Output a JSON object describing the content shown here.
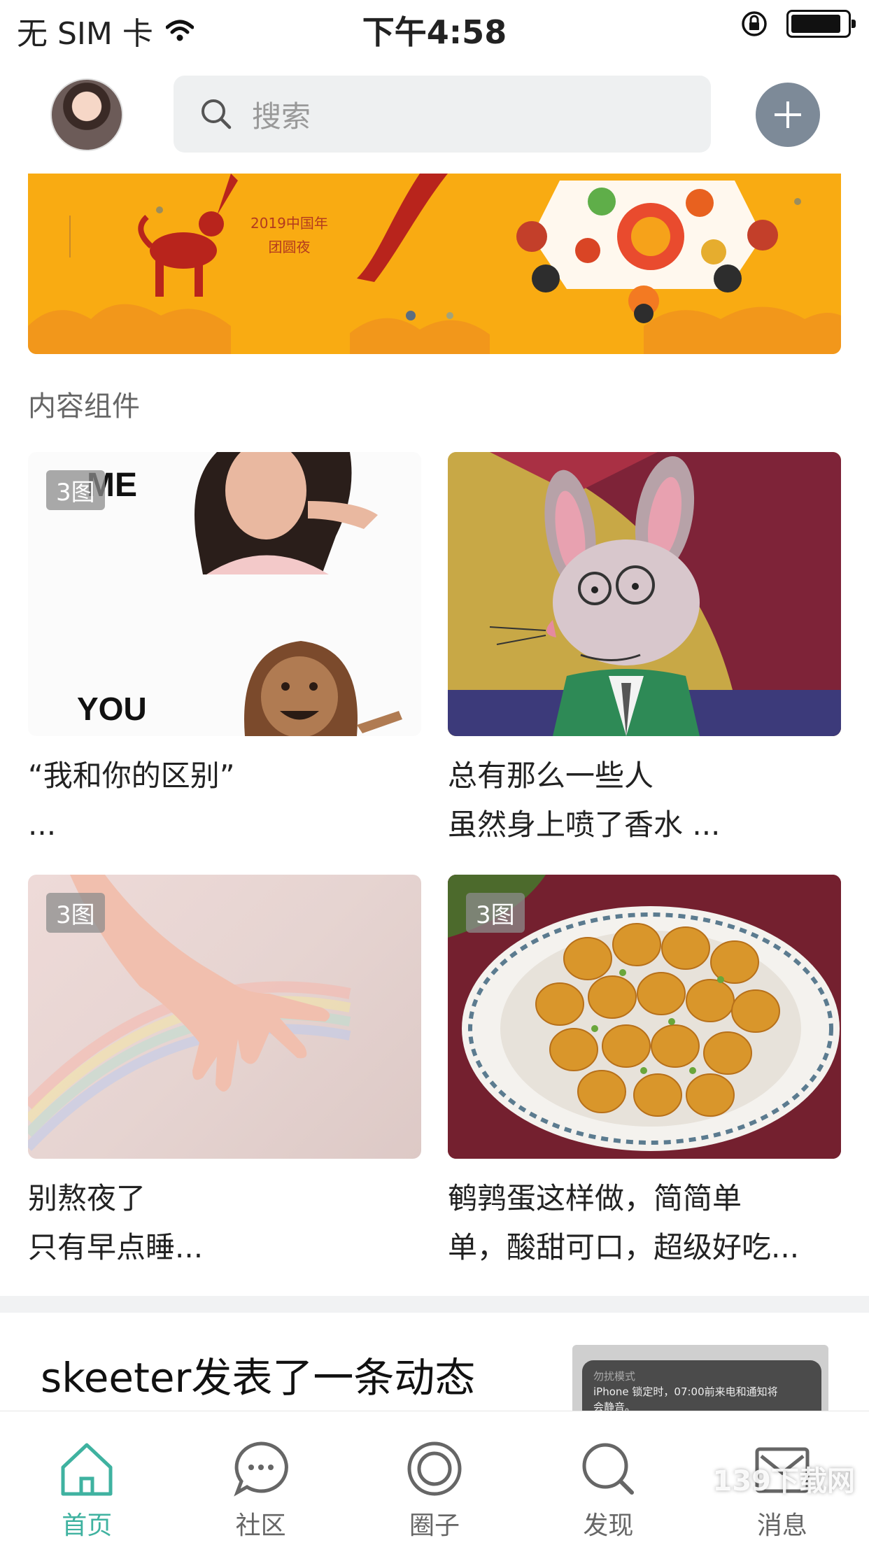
{
  "status_bar": {
    "carrier": "无 SIM 卡",
    "time": "下午4:58",
    "battery_level": 0.9
  },
  "header": {
    "search_placeholder": "搜索"
  },
  "banner": {
    "text_line1": "2019中国年",
    "text_line2": "团圆夜"
  },
  "section": {
    "title": "内容组件"
  },
  "cards": [
    {
      "badge": "3图",
      "line1": "“我和你的区别”",
      "line2": "...",
      "img_text_top": "ME",
      "img_text_bottom": "YOU"
    },
    {
      "badge": "",
      "line1": "总有那么一些人",
      "line2": "虽然身上喷了香水 ..."
    },
    {
      "badge": "3图",
      "line1": "别熬夜了",
      "line2": "只有早点睡..."
    },
    {
      "badge": "3图",
      "line1": "鹌鹑蛋这样做，简简单",
      "line2": "单，酸甜可口，超级好吃..."
    }
  ],
  "post": {
    "text": "skeeter发表了一条动态",
    "thumb_line1": "勿扰模式",
    "thumb_line2": "iPhone 锁定时，07:00前来电和通知将",
    "thumb_line3": "会静音。"
  },
  "tabs": [
    {
      "label": "首页",
      "icon": "home-icon",
      "active": true
    },
    {
      "label": "社区",
      "icon": "chat-icon",
      "active": false
    },
    {
      "label": "圈子",
      "icon": "circle-icon",
      "active": false
    },
    {
      "label": "发现",
      "icon": "search-icon",
      "active": false
    },
    {
      "label": "消息",
      "icon": "mail-icon",
      "active": false
    }
  ],
  "watermark": "139下载网",
  "colors": {
    "accent": "#3fb2a0",
    "banner": "#f9ab12",
    "add_button": "#7d8a98"
  }
}
